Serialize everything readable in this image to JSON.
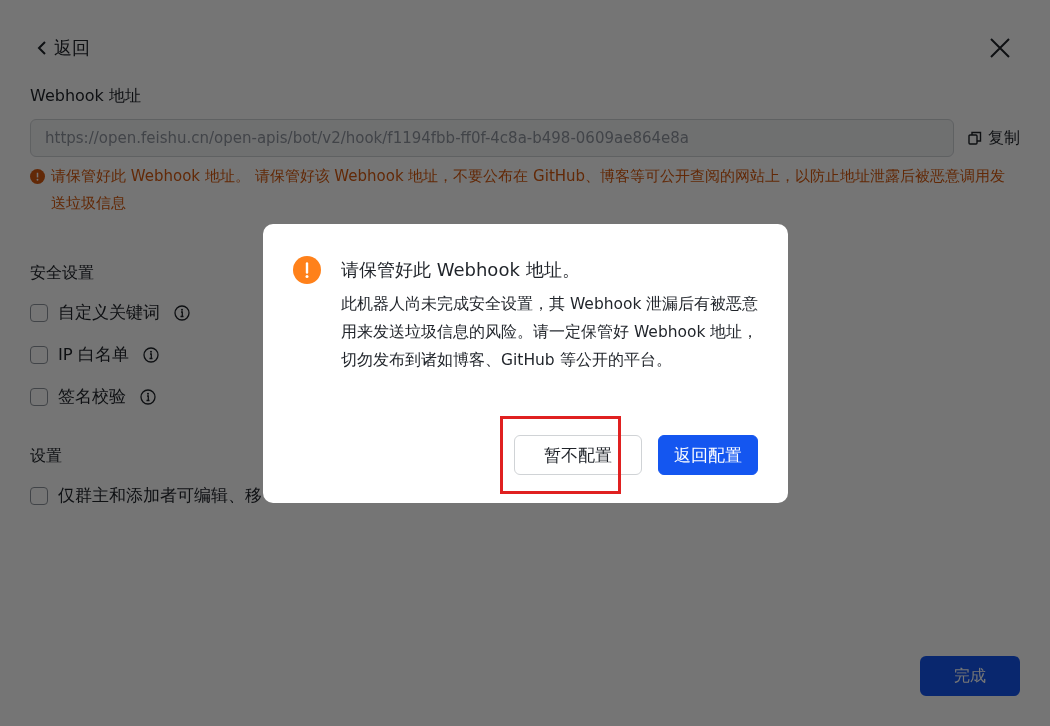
{
  "header": {
    "back_label": "返回"
  },
  "webhook": {
    "label": "Webhook 地址",
    "value": "https://open.feishu.cn/open-apis/bot/v2/hook/f1194fbb-ff0f-4c8a-b498-0609ae864e8a",
    "copy_label": "复制",
    "warning": "请保管好此 Webhook 地址。 请保管好该 Webhook 地址，不要公布在 GitHub、博客等可公开查阅的网站上，以防止地址泄露后被恶意调用发送垃圾信息"
  },
  "security": {
    "title": "安全设置",
    "options": [
      {
        "label": "自定义关键词",
        "checked": false,
        "info": true
      },
      {
        "label": "IP 白名单",
        "checked": false,
        "info": true
      },
      {
        "label": "签名校验",
        "checked": false,
        "info": true
      }
    ]
  },
  "settings": {
    "title": "设置",
    "options": [
      {
        "label": "仅群主和添加者可编辑、移",
        "checked": false
      }
    ]
  },
  "done_button": "完成",
  "modal": {
    "title": "请保管好此 Webhook 地址。",
    "body": "此机器人尚未完成安全设置，其 Webhook 泄漏后有被恶意用来发送垃圾信息的风险。请一定保管好 Webhook 地址，切勿发布到诸如博客、GitHub 等公开的平台。",
    "buttons": [
      {
        "label": "暂不配置",
        "kind": "secondary"
      },
      {
        "label": "返回配置",
        "kind": "primary"
      }
    ]
  }
}
